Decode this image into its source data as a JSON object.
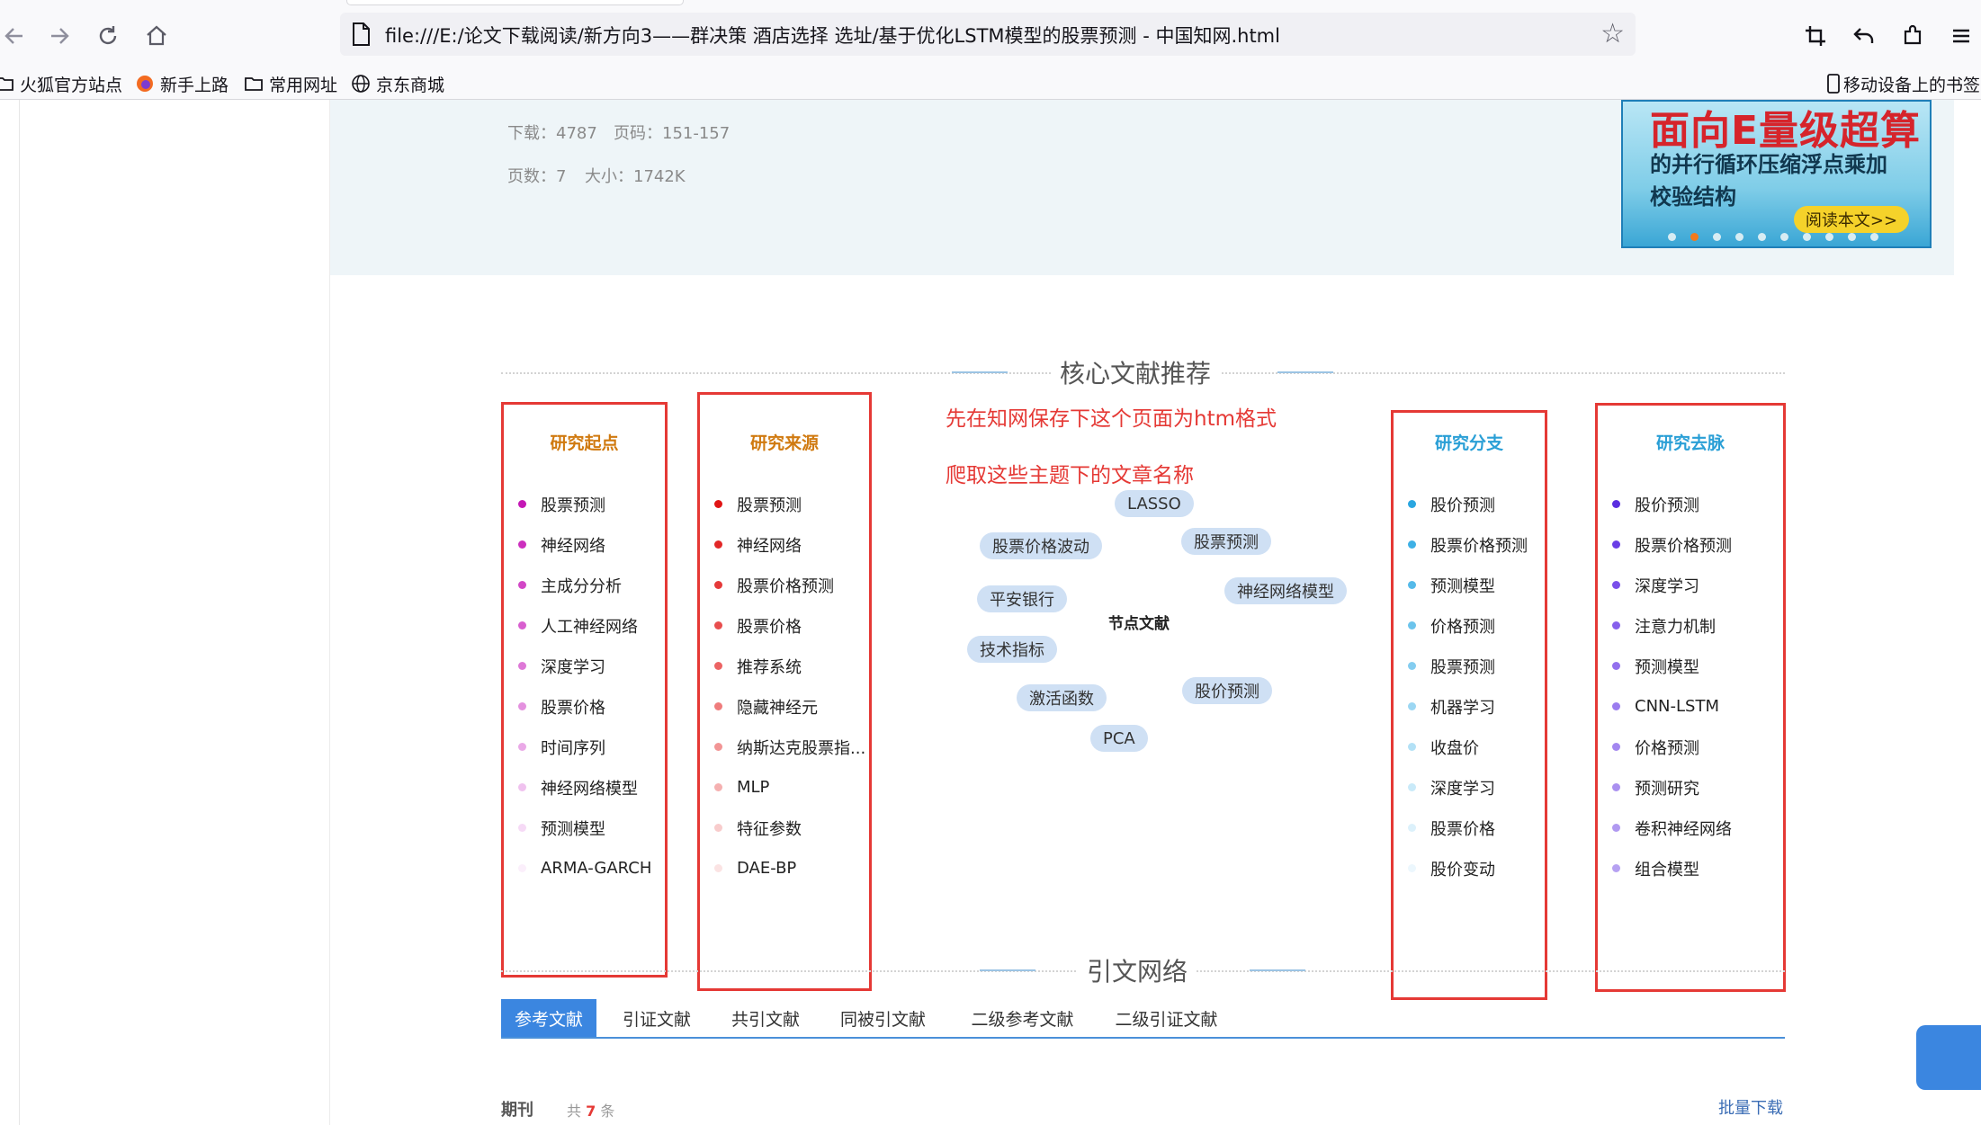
{
  "browser": {
    "url": "file:///E:/论文下载阅读/新方向3——群决策 酒店选择 选址/基于优化LSTM模型的股票预测 - 中国知网.html",
    "bookmarks": [
      "火狐官方站点",
      "新手上路",
      "常用网址",
      "京东商城"
    ],
    "mobile_bookmarks": "移动设备上的书签"
  },
  "article_meta": {
    "downloads": "下载：4787",
    "pages_range": "页码：151-157",
    "page_count": "页数：7",
    "size": "大小：1742K"
  },
  "banner": {
    "line1": "面向E量级超算",
    "line2": "的并行循环压缩浮点乘加",
    "line3": "校验结构",
    "button": "阅读本文>>"
  },
  "core_section": {
    "title": "核心文献推荐",
    "columns": [
      {
        "title": "研究起点",
        "title_color": "#d07a10",
        "items": [
          "股票预测",
          "神经网络",
          "主成分分析",
          "人工神经网络",
          "深度学习",
          "股票价格",
          "时间序列",
          "神经网络模型",
          "预测模型",
          "ARMA-GARCH"
        ],
        "dot_colors": [
          "#c418b5",
          "#cc2fbe",
          "#d247c6",
          "#d85fcf",
          "#de78d7",
          "#e491df",
          "#eaa9e7",
          "#f0c2ef",
          "#f6daf6",
          "#fbeffb"
        ]
      },
      {
        "title": "研究来源",
        "title_color": "#d07a10",
        "items": [
          "股票预测",
          "神经网络",
          "股票价格预测",
          "股票价格",
          "推荐系统",
          "隐藏神经元",
          "纳斯达克股票指...",
          "MLP",
          "特征参数",
          "DAE-BP"
        ],
        "dot_colors": [
          "#e01515",
          "#e22727",
          "#e53a3a",
          "#e84e4e",
          "#ec6464",
          "#ef7c7c",
          "#f29595",
          "#f5b0b0",
          "#f8cccc",
          "#fbe3e3"
        ]
      },
      {
        "title": "研究分支",
        "title_color": "#2a9fd6",
        "items": [
          "股价预测",
          "股票价格预测",
          "预测模型",
          "价格预测",
          "股票预测",
          "机器学习",
          "收盘价",
          "深度学习",
          "股票价格",
          "股价变动"
        ],
        "dot_colors": [
          "#2aa6e0",
          "#3eb0e5",
          "#55bae9",
          "#6cc4ec",
          "#84cdf0",
          "#9cd7f3",
          "#b3e1f6",
          "#c9eaf9",
          "#dcf1fb",
          "#ecf7fd"
        ]
      },
      {
        "title": "研究去脉",
        "title_color": "#2a9fd6",
        "items": [
          "股价预测",
          "股票价格预测",
          "深度学习",
          "注意力机制",
          "预测模型",
          "CNN-LSTM",
          "价格预测",
          "预测研究",
          "卷积神经网络",
          "组合模型"
        ],
        "dot_colors": [
          "#5a2ee0",
          "#6a3ee6",
          "#7a4fea",
          "#8660ec",
          "#9370ee",
          "#9b7cef",
          "#a387f0",
          "#aa90f0",
          "#b099f1",
          "#b6a1f2"
        ]
      }
    ],
    "annotation_line1": "先在知网保存下这个页面为htm格式",
    "annotation_line2": "爬取这些主题下的文章名称",
    "cloud": {
      "center": "节点文献",
      "chips": [
        "LASSO",
        "股票价格波动",
        "股票预测",
        "平安银行",
        "神经网络模型",
        "技术指标",
        "激活函数",
        "股价预测",
        "PCA"
      ]
    }
  },
  "citation_section": {
    "title": "引文网络",
    "tabs": [
      "参考文献",
      "引证文献",
      "共引文献",
      "同被引文献",
      "二级参考文献",
      "二级引证文献"
    ],
    "active_tab": 0,
    "journal_label": "期刊",
    "count_prefix": "共",
    "count": "7",
    "count_suffix": "条",
    "batch_download": "批量下载"
  }
}
